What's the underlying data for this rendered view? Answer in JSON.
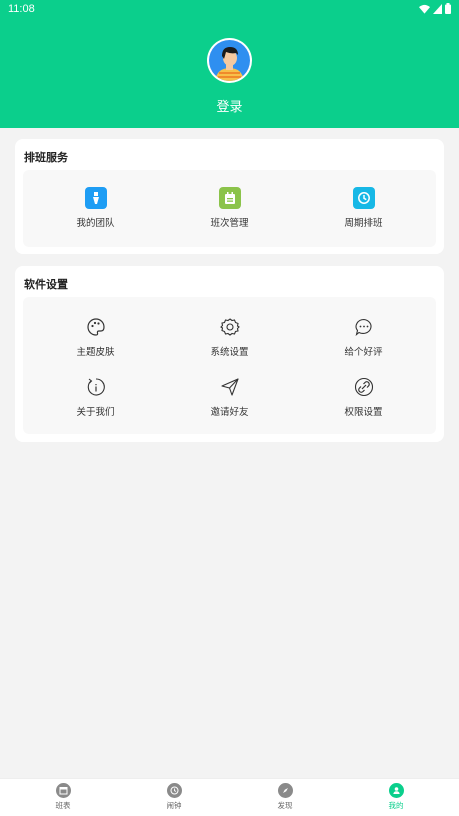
{
  "status_bar": {
    "time": "11:08"
  },
  "profile": {
    "login_label": "登录"
  },
  "scheduling": {
    "title": "排班服务",
    "items": [
      {
        "label": "我的团队",
        "icon": "team-icon",
        "color": "#1e9df4"
      },
      {
        "label": "班次管理",
        "icon": "shift-icon",
        "color": "#8bc34a"
      },
      {
        "label": "周期排班",
        "icon": "cycle-icon",
        "color": "#17b8e6"
      }
    ]
  },
  "settings": {
    "title": "软件设置",
    "items": [
      {
        "label": "主题皮肤",
        "icon": "palette-icon"
      },
      {
        "label": "系统设置",
        "icon": "gear-icon"
      },
      {
        "label": "给个好评",
        "icon": "comment-icon"
      },
      {
        "label": "关于我们",
        "icon": "info-icon"
      },
      {
        "label": "邀请好友",
        "icon": "send-icon"
      },
      {
        "label": "权限设置",
        "icon": "link-icon"
      }
    ]
  },
  "tabbar": {
    "tabs": [
      {
        "label": "班表",
        "icon": "calendar-icon",
        "active": false
      },
      {
        "label": "闹钟",
        "icon": "clock-icon",
        "active": false
      },
      {
        "label": "发现",
        "icon": "discover-icon",
        "active": false
      },
      {
        "label": "我的",
        "icon": "user-icon",
        "active": true
      }
    ]
  },
  "colors": {
    "brand": "#0bcf8c",
    "background": "#f3f3f3"
  }
}
